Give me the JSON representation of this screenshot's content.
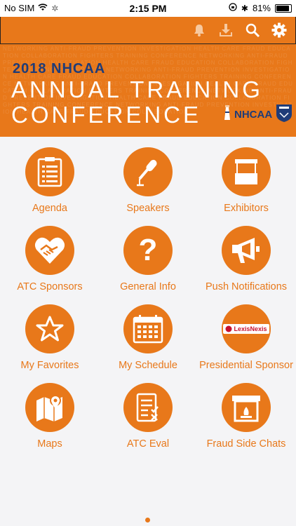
{
  "status_bar": {
    "carrier": "No SIM",
    "time": "2:15 PM",
    "battery": "81%"
  },
  "toolbar": {
    "icons": [
      "bell-icon",
      "download-icon",
      "search-icon",
      "gear-icon"
    ]
  },
  "banner": {
    "year_line": "2018 NHCAA",
    "line1": "ANNUAL TRAINING",
    "line2": "CONFERENCE",
    "logo_text": "NHCAA",
    "pattern_text": "NETWORKING ANTI-FRAUD PREVENTION INVESTIGATION HEALTH CARE FRAUD EDUCATION COLLABORATION FIGHTERS TRAINING CONFERENCE NETWORKING ANTI-FRAUD PREVENTION INVESTIGATION HEALTH CARE FRAUD EDUCATION COLLABORATION FIGHTERS TRAINING CONFERENCE NETWORKING ANTI-FRAUD PREVENTION INVESTIGATION HEALTH CARE FRAUD EDUCATION COLLABORATION FIGHTERS TRAINING CONFERENCE NETWORKING ANTI-FRAUD PREVENTION INVESTIGATION HEALTH CARE FRAUD EDUCATION COLLABORATION FIGHTERS TRAINING CONFERENCE NETWORKING ANTI-FRAUD PREVENTION INVESTIGATION HEALTH CARE FRAUD EDUCATION COLLABORATION FIGHTERS TRAINING CONFERENCE NETWORKING ANTI-FRAUD PREVENTION INVESTIGATION HEALTH CARE FRAUD EDUCATION COLLABORATION"
  },
  "tiles": [
    {
      "label": "Agenda",
      "icon": "agenda-list-icon"
    },
    {
      "label": "Speakers",
      "icon": "microphone-icon"
    },
    {
      "label": "Exhibitors",
      "icon": "booth-icon"
    },
    {
      "label": "ATC Sponsors",
      "icon": "handshake-heart-icon"
    },
    {
      "label": "General Info",
      "icon": "question-mark-icon"
    },
    {
      "label": "Push Notifications",
      "icon": "megaphone-icon"
    },
    {
      "label": "My Favorites",
      "icon": "star-icon"
    },
    {
      "label": "My Schedule",
      "icon": "calendar-icon"
    },
    {
      "label": "Presidential Sponsor",
      "icon": "lexisnexis-logo",
      "logo_text": "LexisNexis"
    },
    {
      "label": "Maps",
      "icon": "map-pin-icon"
    },
    {
      "label": "ATC Eval",
      "icon": "evaluation-form-icon"
    },
    {
      "label": "Fraud Side Chats",
      "icon": "fireplace-icon"
    }
  ],
  "colors": {
    "accent": "#e8781a",
    "navy": "#1f3c78",
    "background": "#f4f4f6"
  }
}
